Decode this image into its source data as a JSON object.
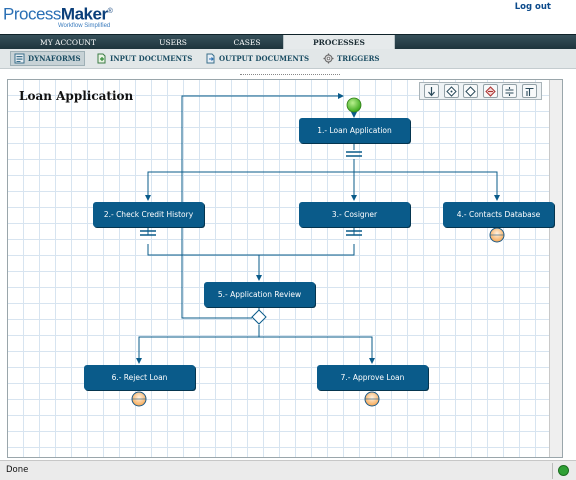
{
  "header": {
    "brand_part1": "Process",
    "brand_part2": "Maker",
    "brand_mark": "®",
    "tagline": "Workflow Simplified",
    "logout": "Log out"
  },
  "main_nav": [
    "MY ACCOUNT",
    "USERS",
    "CASES",
    "PROCESSES"
  ],
  "main_nav_active": "PROCESSES",
  "sub_nav": [
    {
      "label": "DYNAFORMS",
      "icon": "dynaforms-icon",
      "active": true
    },
    {
      "label": "INPUT DOCUMENTS",
      "icon": "input-documents-icon",
      "active": false
    },
    {
      "label": "OUTPUT DOCUMENTS",
      "icon": "output-documents-icon",
      "active": false
    },
    {
      "label": "TRIGGERS",
      "icon": "triggers-icon",
      "active": false
    }
  ],
  "process": {
    "title": "Loan Application",
    "tasks": [
      "1.- Loan Application",
      "2.- Check Credit History",
      "3.- Cosigner",
      "4.- Contacts Database",
      "5.- Application Review",
      "6.- Reject Loan",
      "7.- Approve Loan"
    ]
  },
  "toolbar_icons": [
    "sequential-icon",
    "selection-icon",
    "evaluation-icon",
    "parallel-icon",
    "parallel-join-icon",
    "end-icon"
  ],
  "status": {
    "text": "Done"
  },
  "colors": {
    "task": "#0a5b8a",
    "connector": "#0a5b8a",
    "grid": "#d7e4f0",
    "nav_dark": "#1e343c",
    "start_event": "#5ac12f",
    "end_event": "#f6a651"
  }
}
